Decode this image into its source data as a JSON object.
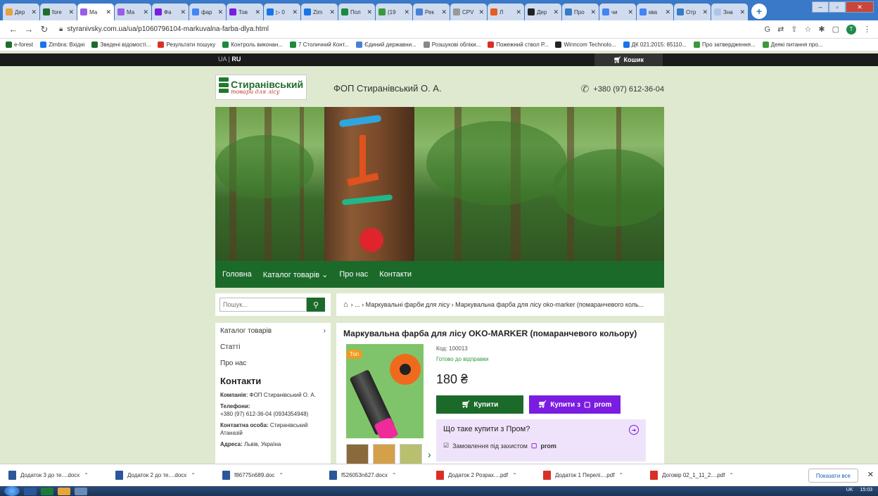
{
  "browser": {
    "tabs": [
      {
        "label": "Дер",
        "color": "#e8a33a",
        "active": false
      },
      {
        "label": "fore",
        "color": "#1f6d2c",
        "active": false
      },
      {
        "label": "Ма",
        "color": "#9b5de5",
        "active": true
      },
      {
        "label": "Ма",
        "color": "#9b5de5",
        "active": false
      },
      {
        "label": "Фа",
        "color": "#7a1de0",
        "active": false
      },
      {
        "label": "фар",
        "color": "#4285f4",
        "active": false
      },
      {
        "label": "Тов",
        "color": "#7a1de0",
        "active": false
      },
      {
        "label": "▷ 0",
        "color": "#1a73e8",
        "active": false
      },
      {
        "label": "Zim",
        "color": "#1a73e8",
        "active": false
      },
      {
        "label": "Пол",
        "color": "#1b8a3c",
        "active": false
      },
      {
        "label": "(19",
        "color": "#3a9a3a",
        "active": false
      },
      {
        "label": "Рек",
        "color": "#4a7fd4",
        "active": false
      },
      {
        "label": "CPV",
        "color": "#999999",
        "active": false
      },
      {
        "label": "Л",
        "color": "#e85a1e",
        "active": false
      },
      {
        "label": "Дер",
        "color": "#222222",
        "active": false
      },
      {
        "label": "Про",
        "color": "#3a78c8",
        "active": false
      },
      {
        "label": "чи",
        "color": "#4285f4",
        "active": false
      },
      {
        "label": "ква",
        "color": "#4285f4",
        "active": false
      },
      {
        "label": "Отр",
        "color": "#3a78c8",
        "active": false
      },
      {
        "label": "Зна",
        "color": "#b0c4e8",
        "active": false
      }
    ],
    "url": "styranivsky.com.ua/ua/p1060796104-markuvalna-farba-dlya.html",
    "bookmarks": [
      {
        "label": "e-forest",
        "color": "#1f6d2c"
      },
      {
        "label": "Zimbra: Вхідні",
        "color": "#1a73e8"
      },
      {
        "label": "Зведені відомості...",
        "color": "#1b6a2a"
      },
      {
        "label": "Результати пошуку",
        "color": "#d93025"
      },
      {
        "label": "Контроль виконан...",
        "color": "#1b8a3c"
      },
      {
        "label": "7 Столичний Конт...",
        "color": "#1b8a3c"
      },
      {
        "label": "Єдиний державни...",
        "color": "#4a7fd4"
      },
      {
        "label": "Розшукові обліки...",
        "color": "#888888"
      },
      {
        "label": "Пожежний ствол Р...",
        "color": "#d93025"
      },
      {
        "label": "Winncom Technolo...",
        "color": "#222222"
      },
      {
        "label": "ДК 021:2015: 85110...",
        "color": "#1a73e8"
      },
      {
        "label": "Про затвердження...",
        "color": "#3a9a3a"
      },
      {
        "label": "Деякі питання про...",
        "color": "#3a9a3a"
      }
    ]
  },
  "site": {
    "lang_ua": "UA",
    "lang_sep": " | ",
    "lang_ru": "RU",
    "cart_label": "Кошик",
    "logo_name": "Стиранівський",
    "logo_sub": "товари для лісу",
    "company": "ФОП Стиранівський О. А.",
    "phone": "+380 (97) 612-36-04",
    "nav": [
      "Головна",
      "Каталог товарів ⌄",
      "Про нас",
      "Контакти"
    ],
    "search_placeholder": "Пошук...",
    "breadcrumb": "› ... › Маркувальні фарби для лісу › Маркувальна фарба для лісу oko-marker (помаранчевого коль...",
    "sidebar": {
      "catalog": "Каталог товарів",
      "articles": "Статті",
      "about": "Про нас",
      "contacts_heading": "Контакти",
      "company_label": "Компанія:",
      "company_value": "ФОП Стиранівський О. А.",
      "phones_label": "Телефони:",
      "phones_value": "+380 (97) 612-36-04 (0934354948)",
      "person_label": "Контактна особа:",
      "person_value": "Стиранівський Атаназій",
      "address_label": "Адреса:",
      "address_value": "Львів, Україна"
    },
    "product": {
      "title": "Маркувальна фарба для лісу OKO-MARKER (помаранчевого кольору)",
      "badge": "Топ",
      "sku": "Код: 100013",
      "availability": "Готово до відправки",
      "price": "180 ₴",
      "buy_label": "Купити",
      "prom_buy_label": "Купити з",
      "prom_brand": "prom",
      "prom_question": "Що таке купити з Пром?",
      "prom_feature": "Замовлення під захистом",
      "prom_feature_brand": "prom"
    }
  },
  "downloads": {
    "items": [
      {
        "name": "Додаток 3 до те....docx",
        "color": "#2b579a"
      },
      {
        "name": "Додаток 2 до те....docx",
        "color": "#2b579a"
      },
      {
        "name": "f86775n689.doc",
        "color": "#2b579a"
      },
      {
        "name": "f526053n627.docx",
        "color": "#2b579a"
      },
      {
        "name": "Додаток 2 Розрах....pdf",
        "color": "#d93025"
      },
      {
        "name": "Додаток 1 Перелі....pdf",
        "color": "#d93025"
      },
      {
        "name": "Договір 02_1_11_2....pdf",
        "color": "#d93025"
      }
    ],
    "show_all": "Показати все"
  },
  "taskbar": {
    "tray_lang": "UK",
    "clock": "15:03"
  },
  "colors": {
    "brand_green": "#1b6a2a",
    "prom_purple": "#7a1de0",
    "page_bg": "#dfe9cf"
  }
}
